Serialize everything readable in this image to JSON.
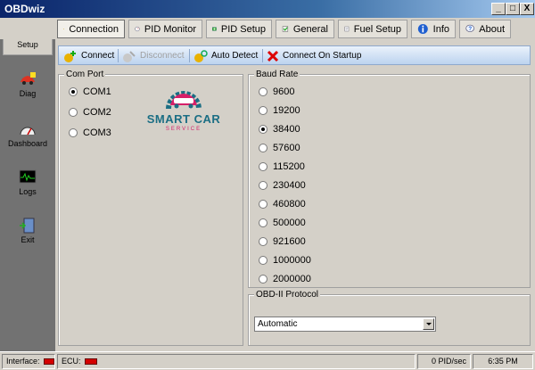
{
  "window": {
    "title": "OBDwiz",
    "minimize": "_",
    "maximize": "□",
    "close": "X"
  },
  "tabs": [
    {
      "label": "Connection",
      "icon": "connection-icon"
    },
    {
      "label": "PID Monitor",
      "icon": "pid-monitor-icon"
    },
    {
      "label": "PID Setup",
      "icon": "pid-setup-icon"
    },
    {
      "label": "General",
      "icon": "general-check-icon"
    },
    {
      "label": "Fuel Setup",
      "icon": "fuel-setup-icon"
    },
    {
      "label": "Info",
      "icon": "info-icon"
    },
    {
      "label": "About",
      "icon": "about-icon"
    }
  ],
  "sidebar": [
    {
      "label": "Setup",
      "icon": "setup-checklist-icon"
    },
    {
      "label": "Diag",
      "icon": "diag-car-icon"
    },
    {
      "label": "Dashboard",
      "icon": "gauge-icon"
    },
    {
      "label": "Logs",
      "icon": "logs-monitor-icon"
    },
    {
      "label": "Exit",
      "icon": "exit-door-icon"
    }
  ],
  "toolbar": {
    "connect": "Connect",
    "disconnect": "Disconnect",
    "auto_detect": "Auto Detect",
    "connect_on_startup": "Connect On Startup"
  },
  "com_port": {
    "legend": "Com Port",
    "options": [
      "COM1",
      "COM2",
      "COM3"
    ],
    "selected": "COM1"
  },
  "logo": {
    "line1": "SMART CAR",
    "line2": "SERVICE"
  },
  "baud_rate": {
    "legend": "Baud Rate",
    "options": [
      "9600",
      "19200",
      "38400",
      "57600",
      "115200",
      "230400",
      "460800",
      "500000",
      "921600",
      "1000000",
      "2000000"
    ],
    "selected": "38400"
  },
  "protocol": {
    "legend": "OBD-II Protocol",
    "value": "Automatic"
  },
  "status": {
    "interface_label": "Interface:",
    "ecu_label": "ECU:",
    "rate": "0 PID/sec",
    "time": "6:35 PM"
  },
  "colors": {
    "accent": "#0a246a",
    "led": "#d40000",
    "logo_pink": "#d61f69",
    "logo_teal": "#1b6e84"
  }
}
